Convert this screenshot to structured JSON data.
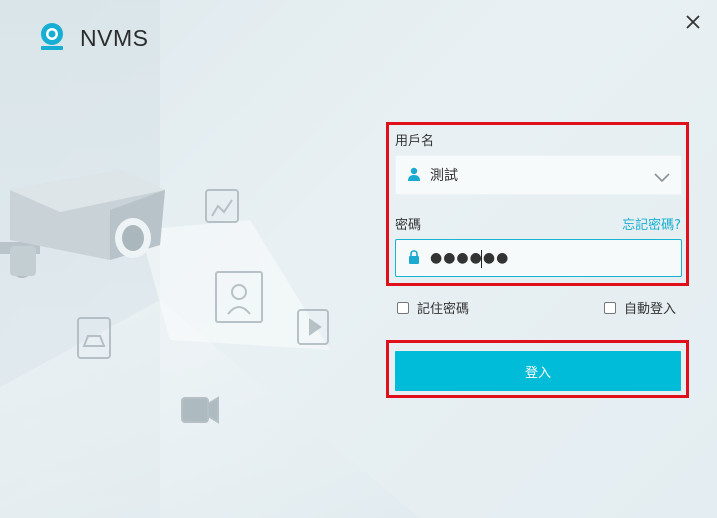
{
  "app": {
    "title": "NVMS"
  },
  "form": {
    "username_label": "用戶名",
    "username_value": "測試",
    "password_label": "密碼",
    "password_value": "●●●●●●",
    "forgot_link": "忘記密碼?",
    "remember_label": "記住密碼",
    "autologin_label": "自動登入",
    "login_button": "登入"
  },
  "colors": {
    "accent": "#00bcd8",
    "highlight": "#e0101a",
    "logo": "#16aed3"
  },
  "icons": {
    "logo": "webcam-icon",
    "close": "close-icon",
    "user": "user-icon",
    "lock": "lock-icon",
    "dropdown": "chevron-down-icon"
  }
}
